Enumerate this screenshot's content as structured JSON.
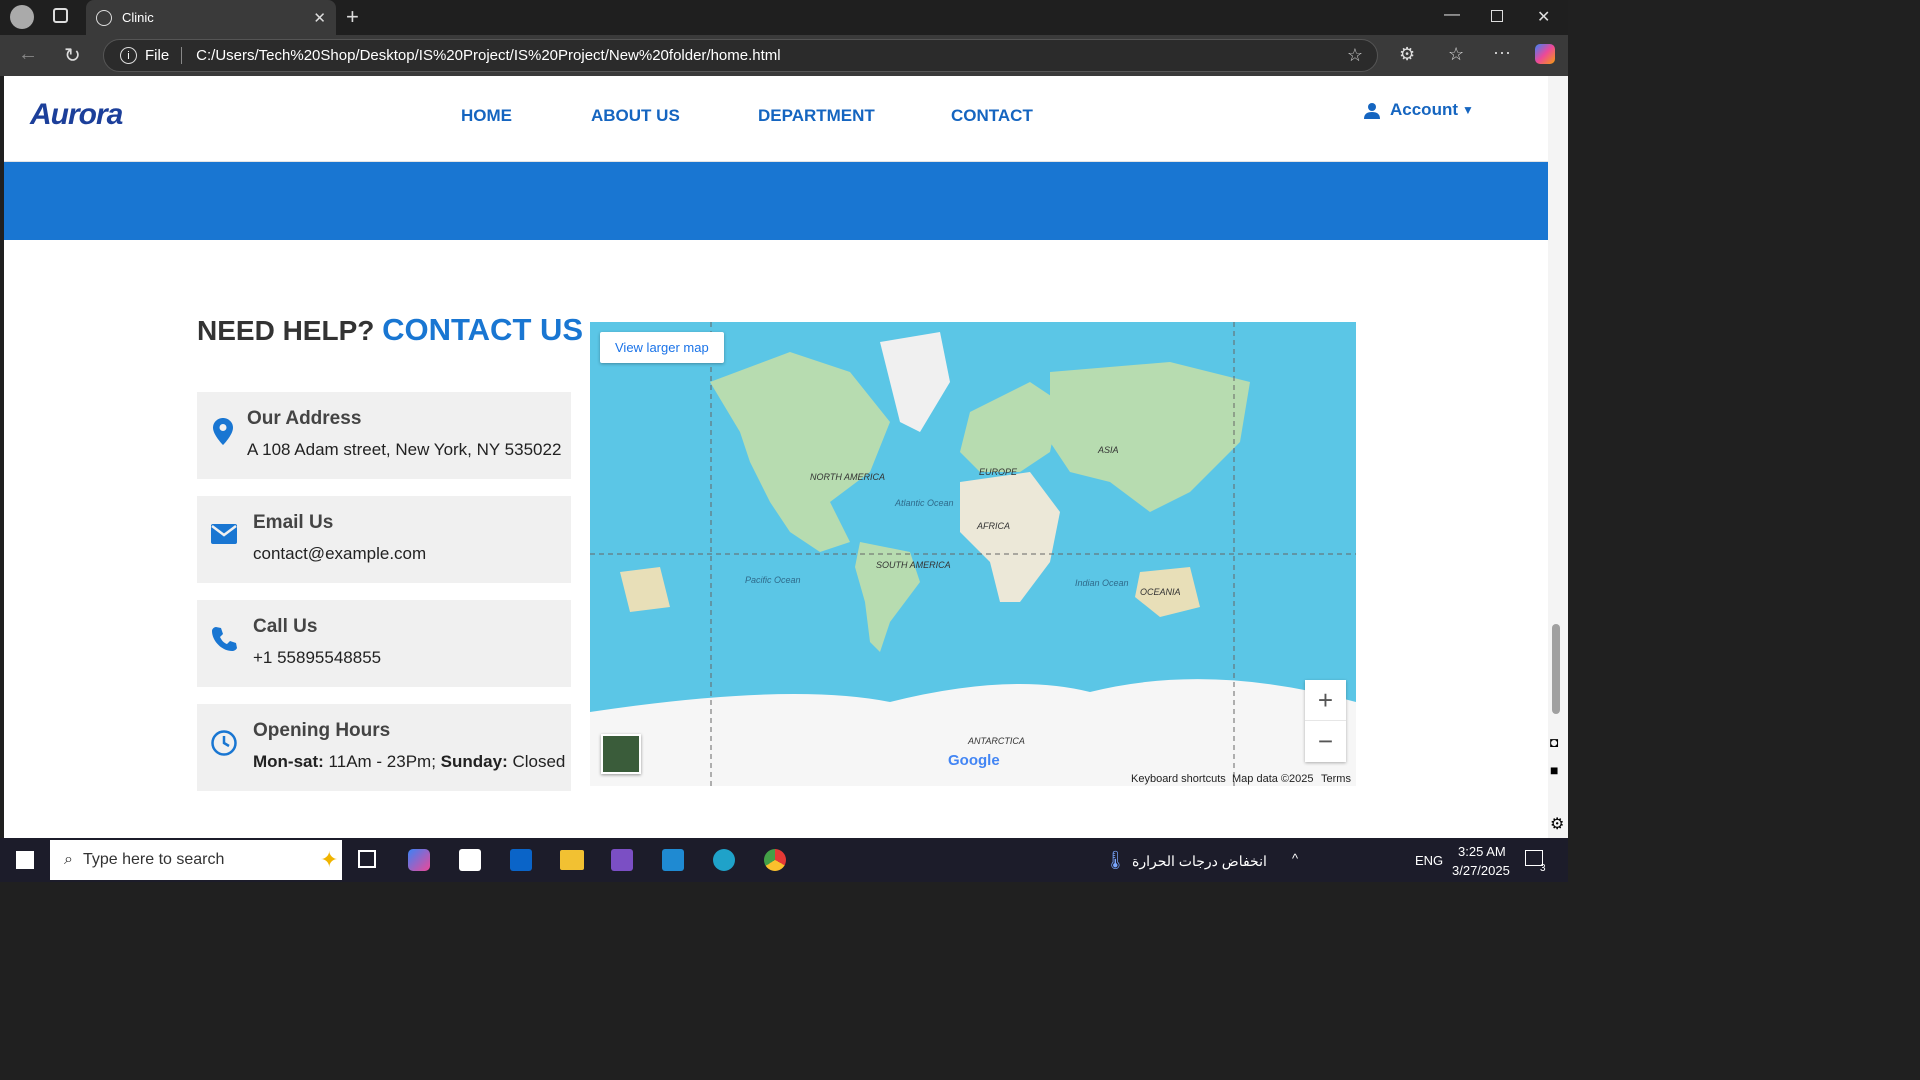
{
  "browser": {
    "tab_title": "Clinic",
    "address_label": "File",
    "url": "C:/Users/Tech%20Shop/Desktop/IS%20Project/IS%20Project/New%20folder/home.html"
  },
  "nav": {
    "logo": "Aurora",
    "items": [
      "HOME",
      "ABOUT US",
      "DEPARTMENT",
      "CONTACT"
    ],
    "account": "Account"
  },
  "contact": {
    "heading_prefix": "NEED HELP?",
    "heading_highlight": "CONTACT US",
    "cards": [
      {
        "title": "Our Address",
        "value": "A 108 Adam street, New York, NY 535022",
        "icon": "location-pin-icon"
      },
      {
        "title": "Email Us",
        "value": "contact@example.com",
        "icon": "envelope-icon"
      },
      {
        "title": "Call Us",
        "value": "+1 55895548855",
        "icon": "phone-icon"
      },
      {
        "title": "Opening Hours",
        "icon": "clock-icon",
        "hours_label1": "Mon-sat:",
        "hours_val1": " 11Am - 23Pm; ",
        "hours_label2": "Sunday:",
        "hours_val2": " Closed"
      }
    ]
  },
  "map": {
    "view_larger": "View larger map",
    "labels": {
      "north_america": "NORTH AMERICA",
      "south_america": "SOUTH AMERICA",
      "europe": "EUROPE",
      "asia": "ASIA",
      "africa": "AFRICA",
      "oceania": "OCEANIA",
      "antarctica": "ANTARCTICA",
      "atlantic": "Atlantic Ocean",
      "pacific": "Pacific Ocean",
      "indian": "Indian Ocean"
    },
    "google": "Google",
    "keyboard": "Keyboard shortcuts",
    "map_data": "Map data ©2025",
    "terms": "Terms"
  },
  "taskbar": {
    "search_placeholder": "Type here to search",
    "weather": "انخفاض درجات الحرارة",
    "lang": "ENG",
    "time": "3:25 AM",
    "date": "3/27/2025",
    "notifications": "3"
  }
}
